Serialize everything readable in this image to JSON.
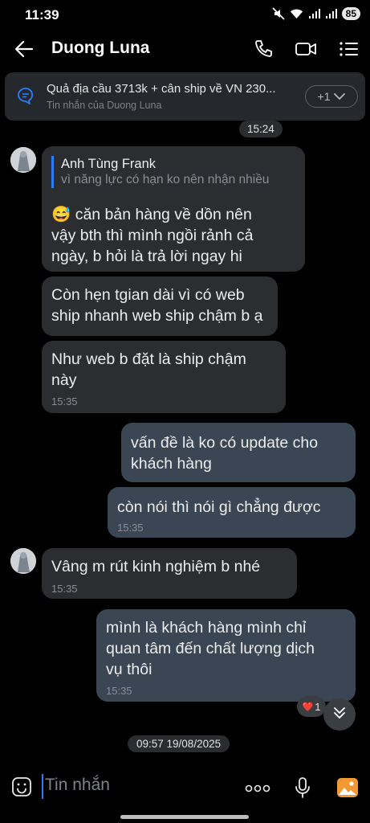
{
  "status_bar": {
    "time": "11:39",
    "battery": "85"
  },
  "header": {
    "title": "Duong Luna"
  },
  "pinned": {
    "title": "Quả địa cầu 3713k + cân ship về VN 230...",
    "subtitle": "Tin nhắn của Duong Luna",
    "more": "+1"
  },
  "date_chips": {
    "top": "15:24",
    "bottom": "09:57 19/08/2025"
  },
  "messages": [
    {
      "quote_author": "Anh Tùng Frank",
      "quote_text": "vì năng lực có hạn ko nên nhận nhiều",
      "emoji": "😅",
      "line1": "căn bản hàng về dồn nên",
      "line2": "vậy bth thì mình ngồi rảnh cả",
      "line3": "ngày, b hỏi là trả lời ngay hi"
    },
    {
      "line1": "Còn hẹn tgian dài vì có web",
      "line2": "ship nhanh web ship chậm b ạ"
    },
    {
      "line1": "Như web b đặt là ship chậm",
      "line2": "này",
      "time": "15:35"
    },
    {
      "line1": "vấn đề là ko có update cho",
      "line2": "khách hàng"
    },
    {
      "line1": "còn nói thì nói gì chẳng được",
      "time": "15:35"
    },
    {
      "line1": "Vâng m rút kinh nghiệm b nhé",
      "time": "15:35"
    },
    {
      "line1": "mình là khách hàng mình chỉ",
      "line2": "quan tâm đến chất lượng dịch",
      "line3": "vụ thôi",
      "time": "15:35"
    }
  ],
  "reaction": {
    "emoji": "❤️",
    "count": "1"
  },
  "input": {
    "placeholder": "Tin nhắn"
  },
  "colors": {
    "accent": "#2e7cf6",
    "incoming_bubble": "#2b2d30",
    "outgoing_bubble": "#3b4654"
  }
}
